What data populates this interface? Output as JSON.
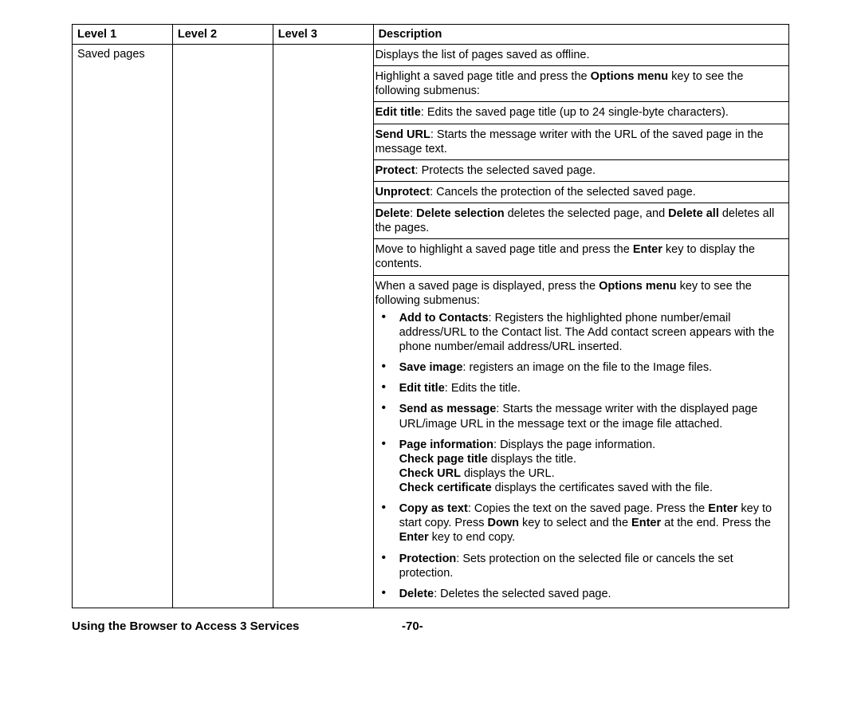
{
  "table": {
    "headers": {
      "l1": "Level 1",
      "l2": "Level 2",
      "l3": "Level 3",
      "desc": "Description"
    },
    "row": {
      "l1": "Saved pages",
      "l2": "",
      "l3": "",
      "p1": "Displays the list of pages saved as offline.",
      "p2a": "Highlight a saved page title and press the ",
      "p2b": "Options menu",
      "p2c": " key to see the following submenus:",
      "p3a": "Edit title",
      "p3b": ": Edits the saved page title (up to 24 single-byte characters).",
      "p4a": "Send URL",
      "p4b": ": Starts the message writer with the URL of the saved page in the message text.",
      "p5a": "Protect",
      "p5b": ": Protects the selected saved page.",
      "p6a": "Unprotect",
      "p6b": ": Cancels the protection of the selected saved page.",
      "p7a": "Delete",
      "p7b": ": ",
      "p7c": "Delete selection",
      "p7d": " deletes the selected page, and ",
      "p7e": "Delete all",
      "p7f": " deletes all the pages.",
      "p8a": "Move to highlight a saved page title and press the ",
      "p8b": "Enter",
      "p8c": " key to display the contents.",
      "p9a": "When a saved page is displayed, press the ",
      "p9b": "Options menu",
      "p9c": " key to see the following submenus:",
      "li1a": "Add to Contacts",
      "li1b": ": Registers the highlighted phone number/email address/URL to the Contact list. The Add contact screen appears with the phone number/email address/URL inserted.",
      "li2a": "Save image",
      "li2b": ": registers an image on the file to the Image files.",
      "li3a": "Edit title",
      "li3b": ": Edits the title.",
      "li4a": "Send as message",
      "li4b": ": Starts the message writer with the displayed page URL/image URL in the message text or the image file attached.",
      "li5a": "Page information",
      "li5b": ": Displays the page information. ",
      "li5c": "Check page title",
      "li5d": " displays the title.",
      "li5e": "Check URL",
      "li5f": " displays the URL.",
      "li5g": "Check certificate",
      "li5h": " displays the certificates saved with the file.",
      "li6a": "Copy as text",
      "li6b": ": Copies the text on the saved page. Press the ",
      "li6c": "Enter",
      "li6d": " key to start copy. Press ",
      "li6e": "Down",
      "li6f": " key to select and the ",
      "li6g": "Enter",
      "li6h": " at the end. Press the ",
      "li6i": "Enter",
      "li6j": " key to end copy.",
      "li7a": "Protection",
      "li7b": ": Sets protection on the selected file or cancels the set protection.",
      "li8a": "Delete",
      "li8b": ": Deletes the selected saved page."
    }
  },
  "footer": {
    "title": "Using the Browser to Access 3 Services",
    "page": "-70-"
  }
}
